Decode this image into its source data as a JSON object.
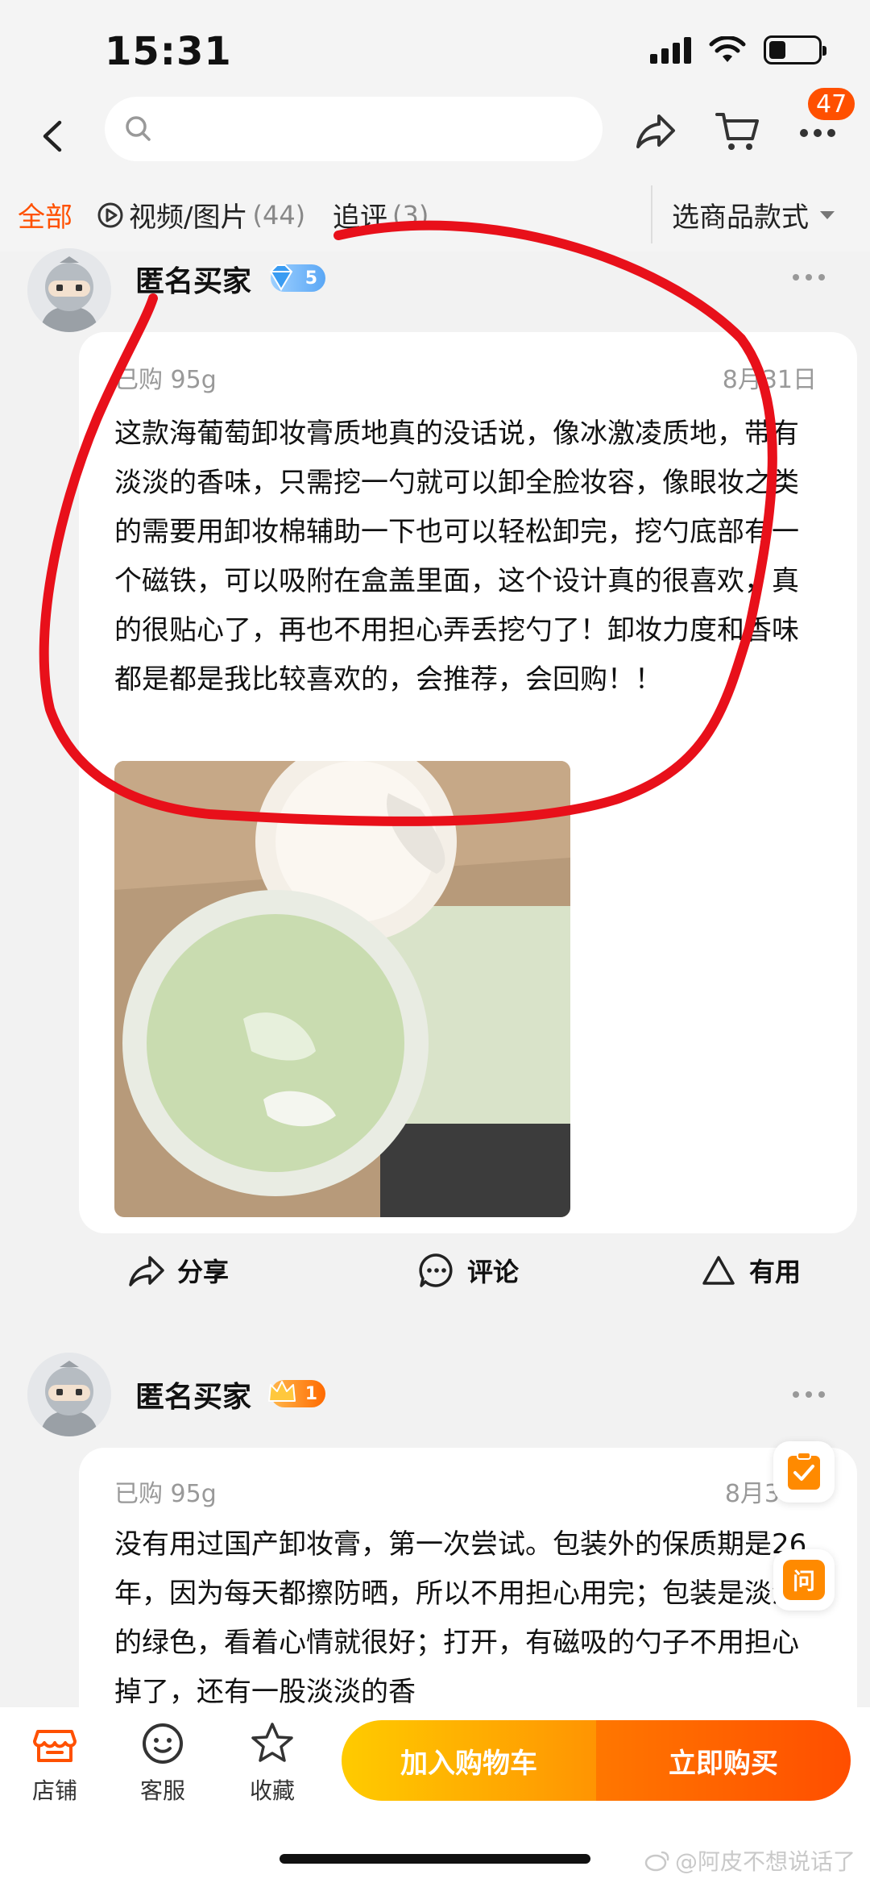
{
  "status_bar": {
    "time": "15:31"
  },
  "header": {
    "cart_badge": "47",
    "search_placeholder": ""
  },
  "tabs": {
    "all": "全部",
    "video_label": "视频/图片",
    "video_count": "(44)",
    "follow_label": "追评",
    "follow_count": "(3)",
    "select_style": "选商品款式"
  },
  "reviews": [
    {
      "username": "匿名买家",
      "level": "5",
      "purchased": "已购 95g",
      "date": "8月31日",
      "text": "这款海葡萄卸妆膏质地真的没话说，像冰激凌质地，带有淡淡的香味，只需挖一勺就可以卸全脸妆容，像眼妆之类的需要用卸妆棉辅助一下也可以轻松卸完，挖勺底部有一个磁铁，可以吸附在盒盖里面，这个设计真的很喜欢，真的很贴心了，再也不用担心弄丢挖勺了！卸妆力度和香味都是都是我比较喜欢的，会推荐，会回购！！",
      "share": "分享",
      "comment": "评论",
      "useful": "有用"
    },
    {
      "username": "匿名买家",
      "level": "1",
      "purchased": "已购 95g",
      "date": "8月3",
      "text": "没有用过国产卸妆膏，第一次尝试。包装外的保质期是26年，因为每天都擦防晒，所以不用担心用完；包装是淡淡的绿色，看着心情就很好；打开，有磁吸的勺子不用担心掉了，还有一股淡淡的香"
    }
  ],
  "float_buttons": {
    "ask": "问"
  },
  "bottom_bar": {
    "store": "店铺",
    "service": "客服",
    "favorite": "收藏",
    "add_cart": "加入购物车",
    "buy_now": "立即购买"
  },
  "watermark": "@阿皮不想说话了",
  "colors": {
    "accent": "#ff5000",
    "annotation": "#e8101a"
  }
}
